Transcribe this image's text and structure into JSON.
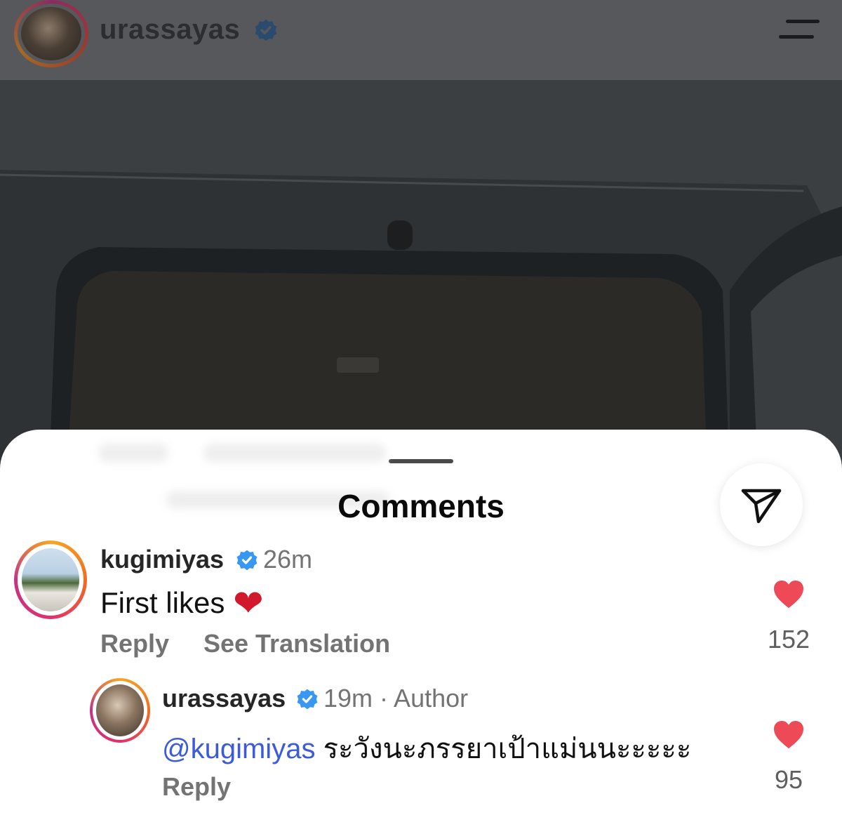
{
  "header": {
    "username": "urassayas",
    "verified": true,
    "menu_icon": "hamburger-menu-icon"
  },
  "sheet": {
    "title": "Comments",
    "share_icon": "paper-plane-icon"
  },
  "comments": [
    {
      "username": "kugimiyas",
      "verified": true,
      "time": "26m",
      "text": "First likes",
      "emoji": "❤️",
      "actions": {
        "reply": "Reply",
        "translate": "See Translation"
      },
      "likes": "152",
      "liked": true
    },
    {
      "username": "urassayas",
      "verified": true,
      "time": "19m",
      "role": "· Author",
      "mention": "@kugimiyas",
      "text": "ระวังนะภรรยาเป้าแม่นนะะะะะ",
      "actions": {
        "reply": "Reply"
      },
      "likes": "95",
      "liked": true
    }
  ],
  "colors": {
    "like_red": "#ed4956",
    "verified_blue": "#3897f0",
    "mention_blue": "#3b5bdb"
  }
}
